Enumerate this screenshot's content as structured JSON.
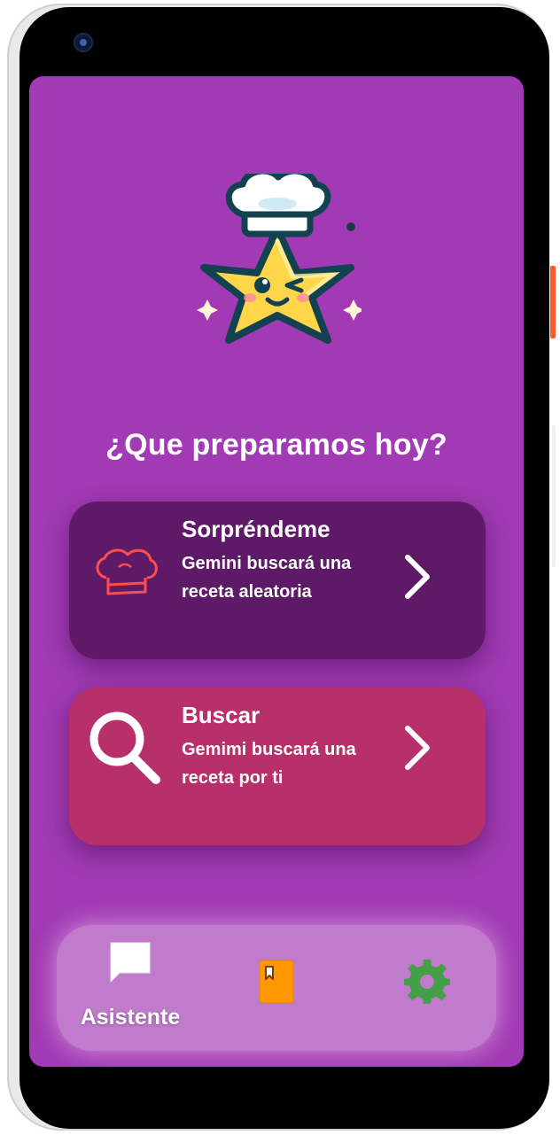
{
  "main": {
    "title": "¿Que preparamos hoy?"
  },
  "cards": {
    "surprise": {
      "title": "Sorpréndeme",
      "description": "Gemini buscará una receta aleatoria"
    },
    "search": {
      "title": "Buscar",
      "description": "Gemimi buscará una receta por ti"
    }
  },
  "bottom_nav": {
    "items": [
      {
        "label": "Asistente",
        "icon": "chat-bubble-icon"
      },
      {
        "label": "",
        "icon": "recipe-book-icon"
      },
      {
        "label": "",
        "icon": "gear-icon"
      }
    ]
  },
  "colors": {
    "screen_background": "#a13ab4",
    "surprise_card": "#5e1a66",
    "search_card": "#b8306a",
    "bottom_bar": "#c07bcc",
    "book_icon": "#ff9800",
    "gear_icon": "#43a047",
    "chef_hat_icon": "#ff4d4d"
  }
}
